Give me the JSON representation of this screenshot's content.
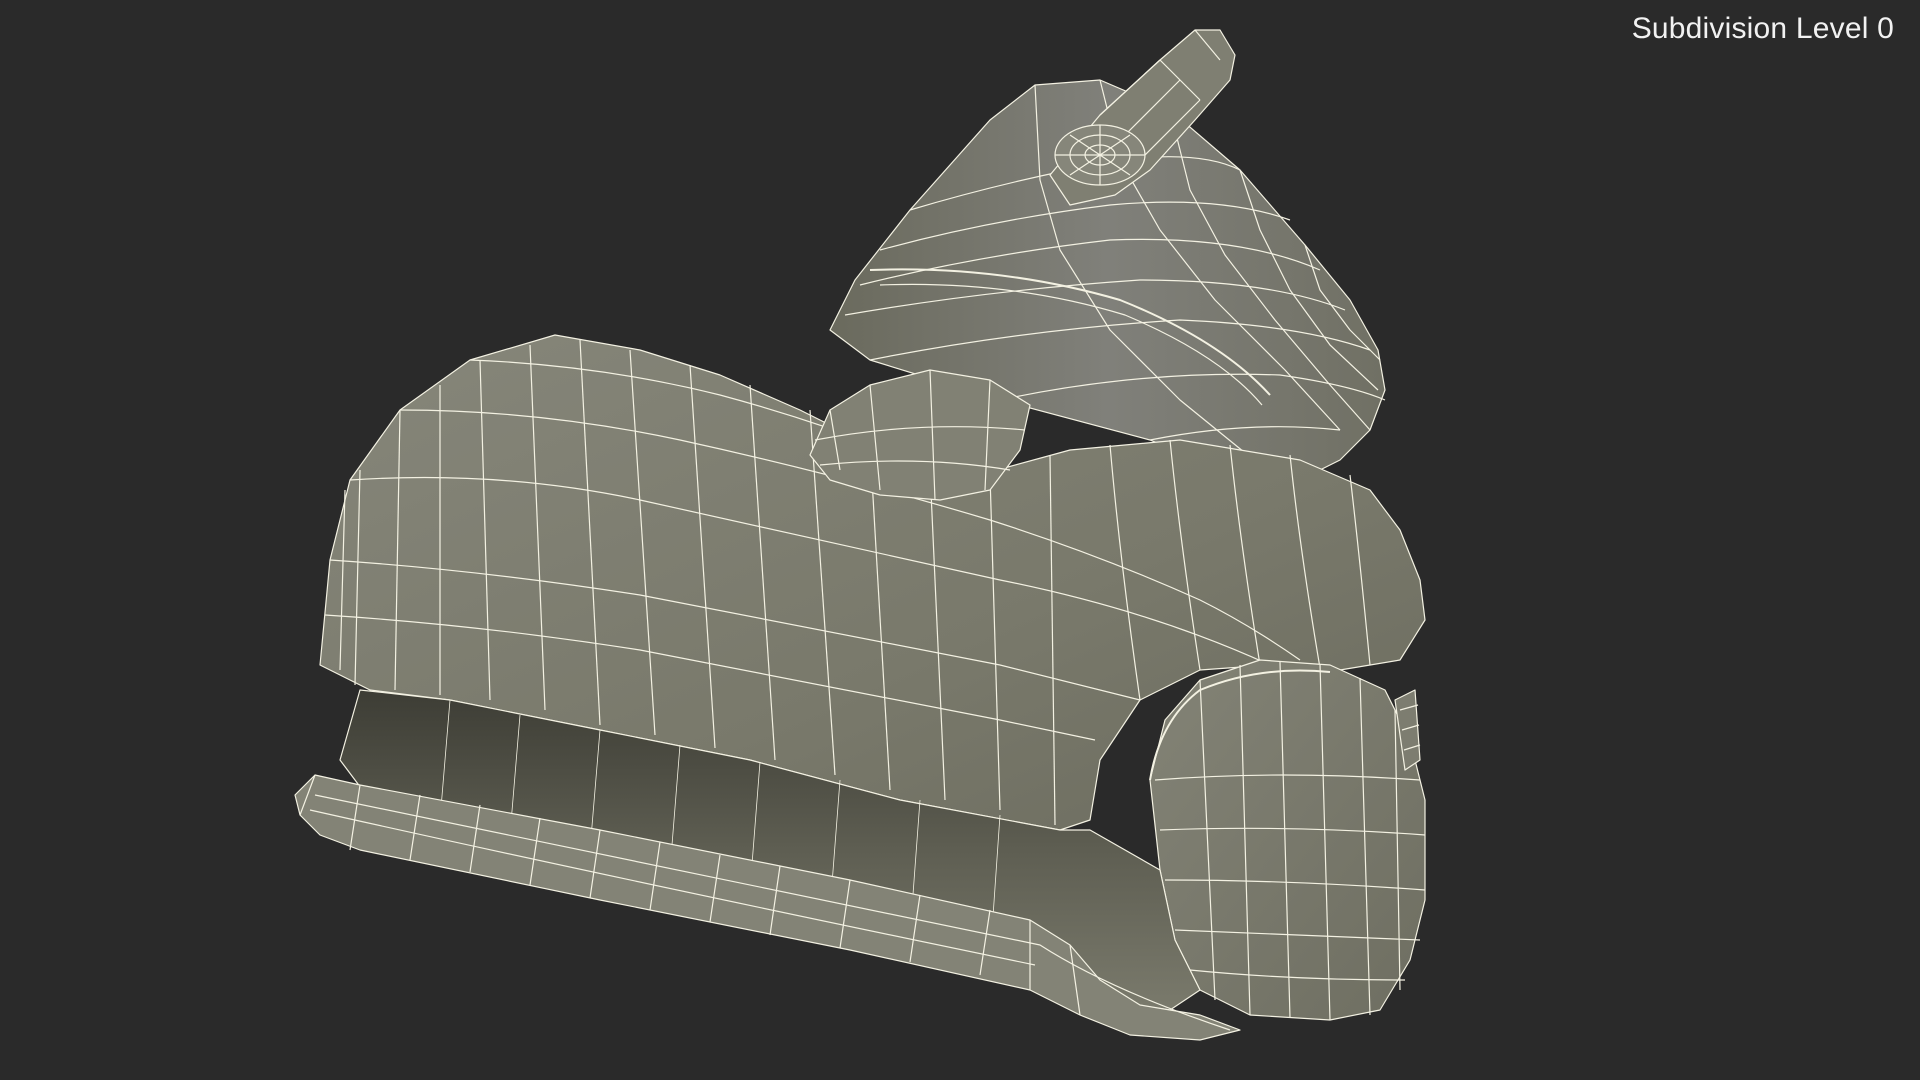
{
  "viewport": {
    "overlay_label": "Subdivision Level 0",
    "background_color": "#2a2a2a",
    "model": {
      "description_icon": "wireframe-mesh-object",
      "surface_color": "#7b7b6d",
      "wire_color": "#f3f1e2"
    }
  }
}
